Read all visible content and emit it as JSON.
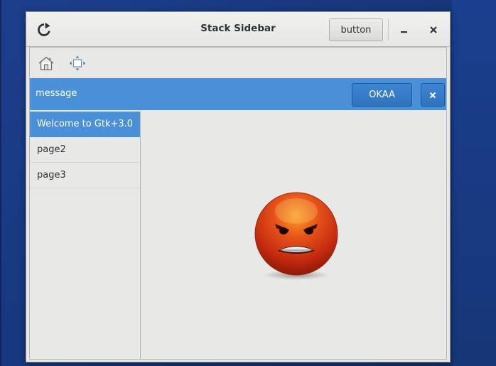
{
  "window": {
    "title": "Stack Sidebar",
    "header_button_label": "button"
  },
  "icons": {
    "reload": "reload-icon",
    "minimize": "minimize-icon",
    "close": "close-icon",
    "home": "home-icon",
    "fullscreen": "fullscreen-icon",
    "info_close": "close-icon",
    "face": "angry-face-icon"
  },
  "infobar": {
    "message": "message",
    "ok_label": "OKAA"
  },
  "sidebar": {
    "items": [
      {
        "label": "Welcome to Gtk+3.0",
        "selected": true
      },
      {
        "label": "page2",
        "selected": false
      },
      {
        "label": "page3",
        "selected": false
      }
    ]
  },
  "colors": {
    "accent": "#4a90d9",
    "desktop": "#1d3e8c"
  }
}
